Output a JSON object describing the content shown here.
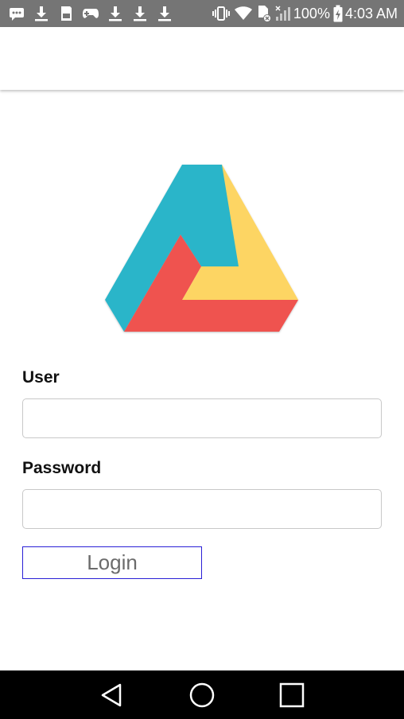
{
  "status_bar": {
    "left_icons": [
      "message-icon",
      "download-icon",
      "sd-card-icon",
      "gamepad-icon",
      "download-icon",
      "download-icon",
      "download-icon"
    ],
    "right_icons": [
      "vibrate-icon",
      "wifi-icon",
      "sim-no-signal-icon",
      "signal-icon"
    ],
    "battery_percent": "100%",
    "time": "4:03 AM"
  },
  "logo": {
    "colors": {
      "teal": "#2ab5c9",
      "yellow": "#fdd563",
      "red": "#ef5250"
    }
  },
  "form": {
    "user_label": "User",
    "user_value": "",
    "password_label": "Password",
    "password_value": "",
    "login_label": "Login",
    "login_border_color": "#2a1fd6"
  },
  "nav_bar": {
    "buttons": [
      "back-icon",
      "home-icon",
      "recents-icon"
    ]
  }
}
